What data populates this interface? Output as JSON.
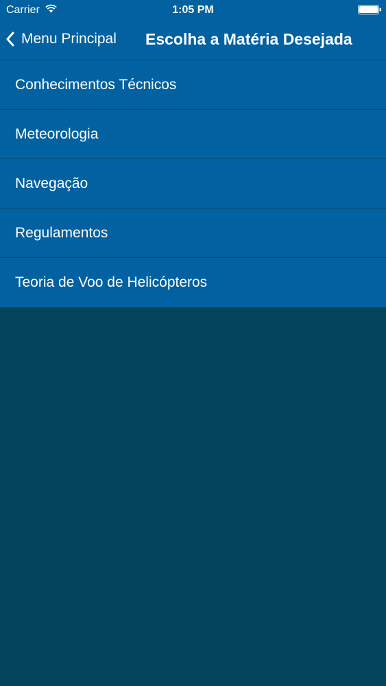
{
  "status_bar": {
    "carrier": "Carrier",
    "time": "1:05 PM",
    "wifi_icon": "wifi-icon",
    "battery_icon": "battery-icon"
  },
  "nav_bar": {
    "back_label": "Menu Principal",
    "back_icon": "chevron-left-icon",
    "title": "Escolha a Matéria Desejada"
  },
  "subjects": [
    {
      "label": "Conhecimentos Técnicos"
    },
    {
      "label": "Meteorologia"
    },
    {
      "label": "Navegação"
    },
    {
      "label": "Regulamentos"
    },
    {
      "label": "Teoria de Voo de Helicópteros"
    }
  ],
  "colors": {
    "header_background": "#0261a0",
    "row_separator": "#024e7f",
    "page_background": "#02445a",
    "text": "#ffffff"
  }
}
